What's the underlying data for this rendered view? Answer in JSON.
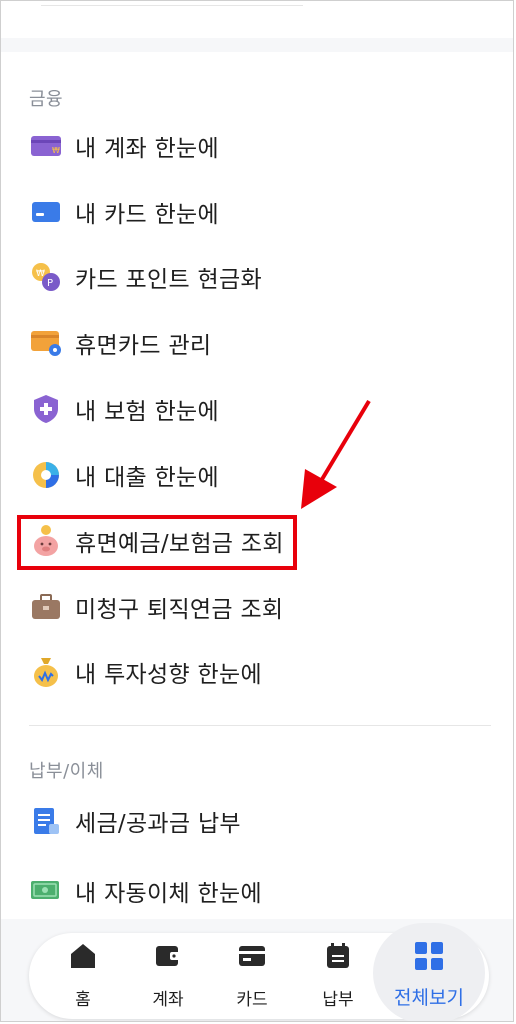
{
  "sections": {
    "finance": {
      "title": "금융",
      "items": [
        {
          "label": "내 계좌 한눈에",
          "icon": "account-card-icon"
        },
        {
          "label": "내 카드 한눈에",
          "icon": "card-icon"
        },
        {
          "label": "카드 포인트 현금화",
          "icon": "points-icon"
        },
        {
          "label": "휴면카드 관리",
          "icon": "dormant-card-icon"
        },
        {
          "label": "내 보험 한눈에",
          "icon": "insurance-shield-icon"
        },
        {
          "label": "내 대출 한눈에",
          "icon": "loan-pie-icon"
        },
        {
          "label": "휴면예금/보험금 조회",
          "icon": "piggy-bank-icon"
        },
        {
          "label": "미청구 퇴직연금 조회",
          "icon": "briefcase-icon"
        },
        {
          "label": "내 투자성향 한눈에",
          "icon": "money-bag-icon"
        }
      ]
    },
    "payment": {
      "title": "납부/이체",
      "items": [
        {
          "label": "세금/공과금 납부",
          "icon": "bill-icon"
        },
        {
          "label": "내 자동이체 한눈에",
          "icon": "auto-transfer-icon"
        }
      ]
    }
  },
  "nav": {
    "items": [
      {
        "label": "홈",
        "icon": "home-icon"
      },
      {
        "label": "계좌",
        "icon": "wallet-icon"
      },
      {
        "label": "카드",
        "icon": "card-nav-icon"
      },
      {
        "label": "납부",
        "icon": "calendar-icon"
      },
      {
        "label": "전체보기",
        "icon": "grid-icon",
        "active": true
      }
    ]
  },
  "colors": {
    "highlight": "#e8000b",
    "active_nav": "#2f6fe6",
    "section_title": "#8a8f98"
  }
}
